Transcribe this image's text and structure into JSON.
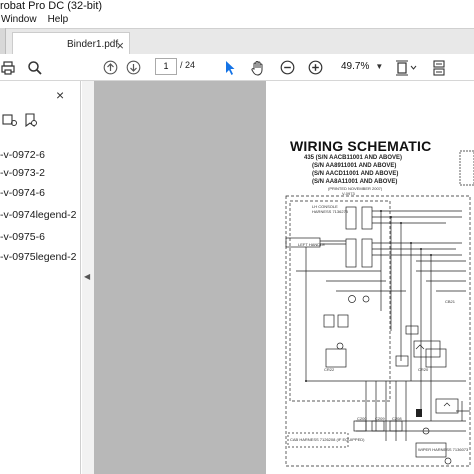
{
  "window": {
    "title": "robat Pro DC (32-bit)"
  },
  "menu": {
    "items": [
      "Window",
      "Help"
    ]
  },
  "tab": {
    "label": "Binder1.pdf",
    "close": "×"
  },
  "toolbar": {
    "current_page": "1",
    "page_count": "/ 24",
    "zoom": "49.7%"
  },
  "sidepanel": {
    "close": "×",
    "bookmarks": [
      "-v-0972-6",
      "-v-0973-2",
      "-v-0974-6",
      "-v-0974legend-2",
      "-v-0975-6",
      "-v-0975legend-2"
    ]
  },
  "document": {
    "title": "WIRING SCHEMATIC",
    "models": [
      "435 (S/N AACB11001 AND ABOVE)",
      "(S/N AA8911001 AND ABOVE)",
      "(S/N AACD11001 AND ABOVE)",
      "(S/N AA8A11001 AND ABOVE)"
    ],
    "printed": "(PRINTED NOVEMBER 2007)",
    "part_no": "V-0973",
    "console_label": "LH CONSOLE",
    "harness_label": "HARNESS 7136275",
    "left_handle": "LEFT HANDLE",
    "connectors": [
      "CR20",
      "CR22",
      "CB21",
      "CB2",
      "C200",
      "C209",
      "C208",
      "C310"
    ],
    "cab_harness": "CAB HARNESS 7126208 (IF EQUIPPED)",
    "wiper_label": "WIPER HARNESS 7136073"
  },
  "colors": {
    "viewer_bg": "#b8b8b8",
    "tab_bar": "#e8e8e8",
    "cursor_blue": "#1473e6"
  }
}
